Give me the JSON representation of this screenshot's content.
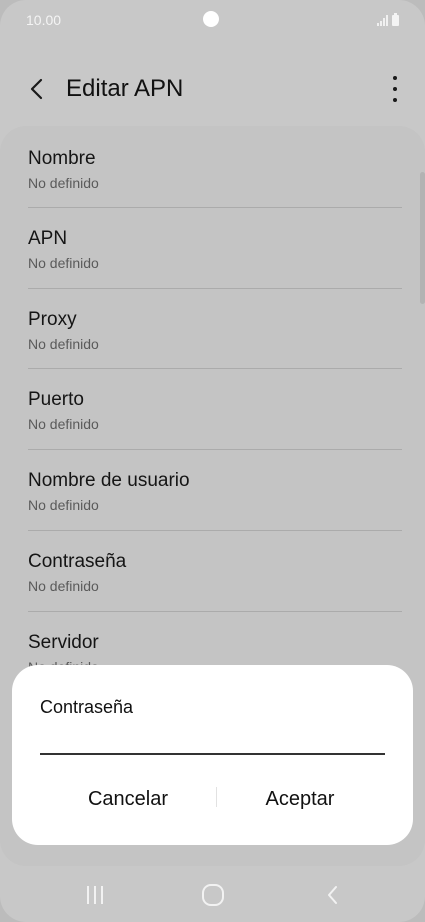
{
  "status_bar": {
    "time": "10.00"
  },
  "app_bar": {
    "title": "Editar APN"
  },
  "settings": [
    {
      "title": "Nombre",
      "value": "No definido"
    },
    {
      "title": "APN",
      "value": "No definido"
    },
    {
      "title": "Proxy",
      "value": "No definido"
    },
    {
      "title": "Puerto",
      "value": "No definido"
    },
    {
      "title": "Nombre de usuario",
      "value": "No definido"
    },
    {
      "title": "Contraseña",
      "value": "No definido"
    },
    {
      "title": "Servidor",
      "value": "No definido"
    }
  ],
  "dialog": {
    "title": "Contraseña",
    "input_value": "",
    "cancel_label": "Cancelar",
    "accept_label": "Aceptar"
  },
  "icons": {
    "back": "chevron-left-icon",
    "more": "more-vertical-icon",
    "nav_recents": "recents-icon",
    "nav_home": "home-icon",
    "nav_back": "back-icon"
  },
  "colors": {
    "background": "#c8c8c8",
    "card": "#c4c4c4",
    "dialog": "#ffffff",
    "text": "#111111",
    "subtext": "#5a5a5a"
  }
}
